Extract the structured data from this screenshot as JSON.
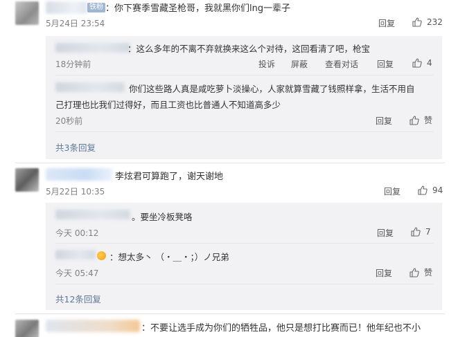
{
  "comments": [
    {
      "badge": "铁粉",
      "text": "：你下赛季雪藏圣枪哥，我就黑你们lng一辈子",
      "time": "5月24日 23:54",
      "reply_label": "回复",
      "like_count": "232",
      "replies": [
        {
          "text": "：这么多年的不离不弃就换来这么个对待，这回看清了吧，枪宝",
          "time": "18分钟前",
          "report": "投诉",
          "block": "屏蔽",
          "view_conv": "查看对话",
          "reply_label": "回复",
          "like_count": "4"
        },
        {
          "text_line1": "你们这些路人真是咸吃萝卜淡操心，人家就算雪藏了钱照样拿，生活不用自",
          "text_line2": "己打理也比我们过得好，而且工资也比普通人不知道高多少",
          "time": "20秒前",
          "reply_label": "回复",
          "like_label": "赞"
        }
      ],
      "more_replies": "共3条回复"
    },
    {
      "text": "李炫君可算跑了，谢天谢地",
      "time": "5月22日 10:35",
      "reply_label": "回复",
      "like_count": "94",
      "replies": [
        {
          "text": "。要坐冷板凳咯",
          "time": "今天 00:12",
          "reply_label": "回复",
          "like_count": "7"
        },
        {
          "text": "：想太多丶 （・＿・；）ノ兄弟",
          "time": "今天 05:47",
          "reply_label": "回复",
          "like_label": "赞"
        }
      ],
      "more_replies": "共12条回复"
    },
    {
      "text": "：不要让选手成为你们的牺牲品，他只是想打比赛而已！他年纪也不小"
    }
  ],
  "icons": {
    "like": "thumbs-up-icon",
    "emoji": "emoji-icon"
  }
}
